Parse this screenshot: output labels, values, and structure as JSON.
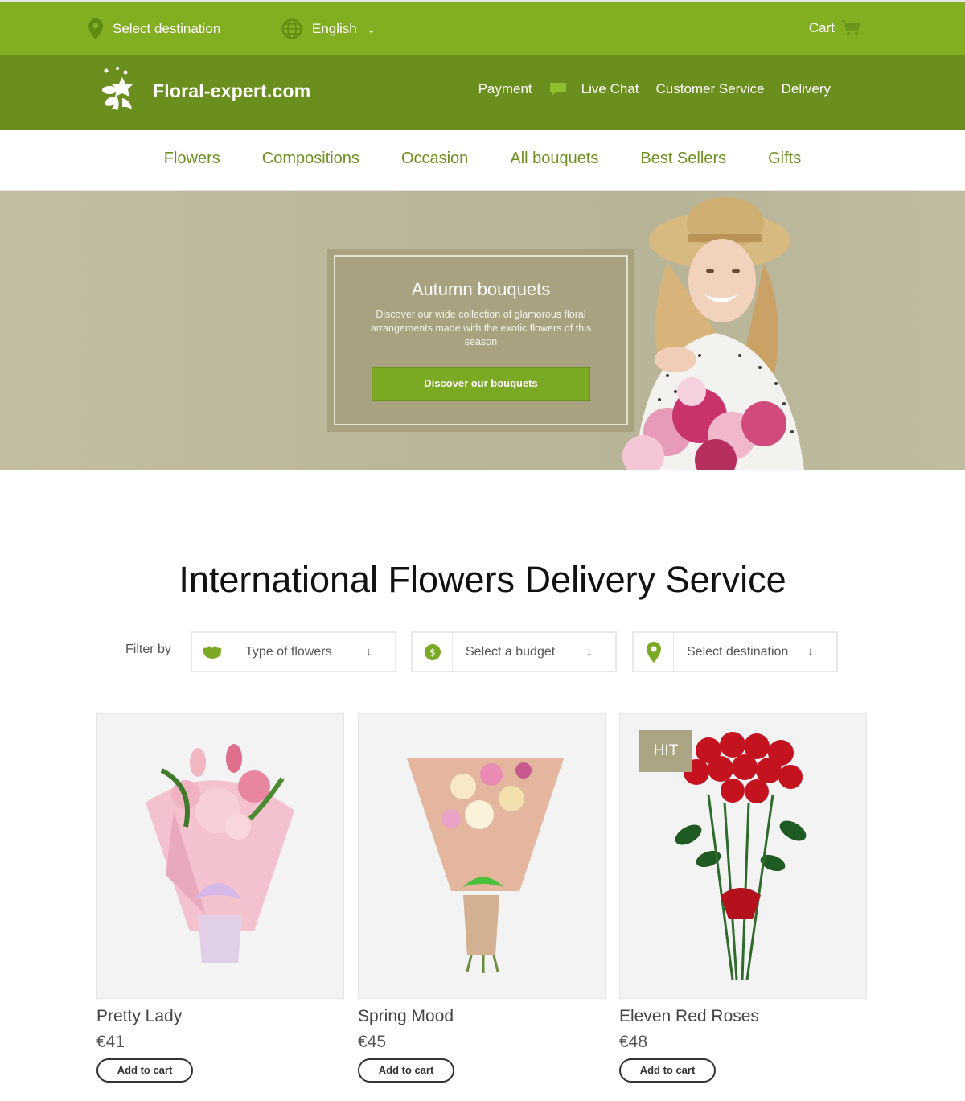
{
  "topbar": {
    "destination": "Select destination",
    "language": "English",
    "cart": "Cart"
  },
  "brand": {
    "logo_text": "Floral-expert.com"
  },
  "toplinks": {
    "payment": "Payment",
    "live_chat": "Live Chat",
    "customer_service": "Customer Service",
    "delivery": "Delivery"
  },
  "nav": [
    "Flowers",
    "Compositions",
    "Occasion",
    "All bouquets",
    "Best Sellers",
    "Gifts"
  ],
  "hero": {
    "title": "Autumn bouquets",
    "text": "Discover our wide collection of glamorous floral arrangements made with the exotic flowers of this season",
    "button": "Discover our bouquets"
  },
  "section_title": "International Flowers Delivery Service",
  "filters": {
    "label": "Filter by",
    "type": "Type of flowers",
    "budget": "Select a budget",
    "destination": "Select destination"
  },
  "products": [
    {
      "name": "Pretty Lady",
      "price": "€41",
      "add": "Add to cart"
    },
    {
      "name": "Spring Mood",
      "price": "€45",
      "add": "Add to cart"
    },
    {
      "name": "Eleven Red Roses",
      "price": "€48",
      "add": "Add to cart",
      "badge": "HIT"
    }
  ],
  "colors": {
    "topbar": "#84ae22",
    "brandbar": "#6b8f1e",
    "accent": "#7ba924",
    "hero_bg": "#bcb89c"
  }
}
